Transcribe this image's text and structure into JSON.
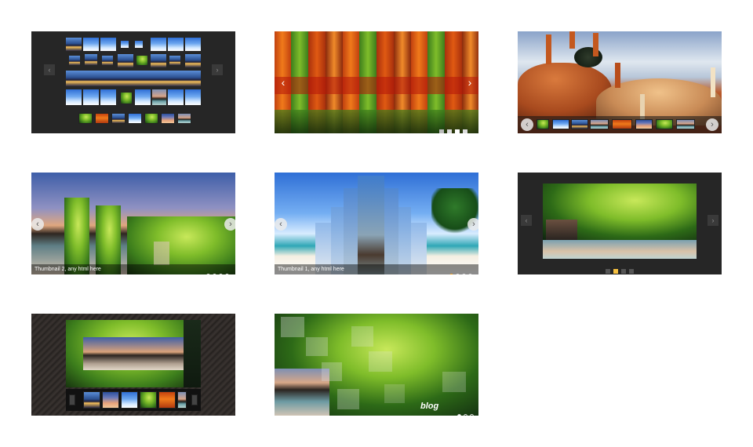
{
  "slider_demos": {
    "caption_thumbnail_2": "Thumbnail 2, any html here",
    "caption_thumbnail_1": "Thumbnail 1, any html here",
    "logo_text": "blog",
    "arrow_left": "‹",
    "arrow_right": "›"
  },
  "colors": {
    "dark_panel": "#262626",
    "active_bullet": "#f39c12",
    "caption_bar": "#000000"
  }
}
